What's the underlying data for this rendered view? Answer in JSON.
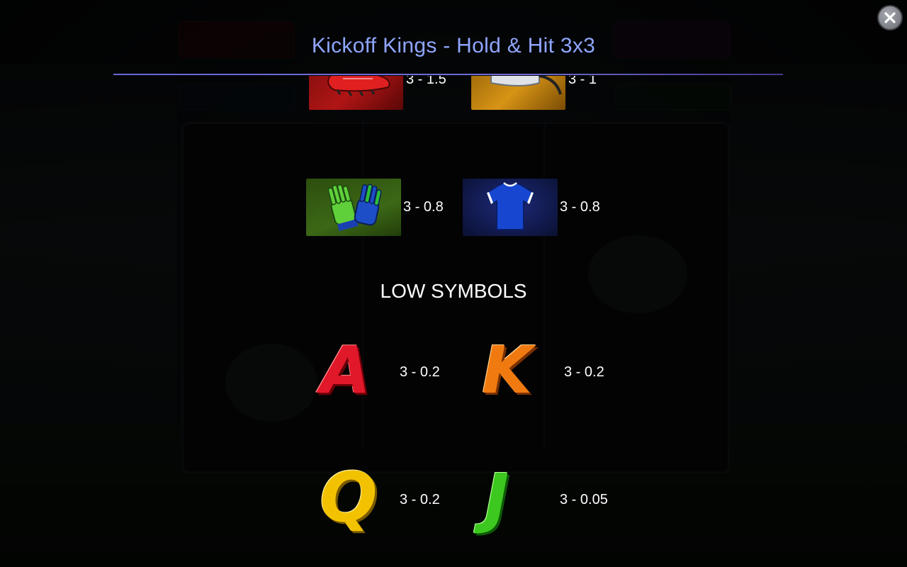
{
  "game": {
    "title": "Kickoff Kings - Hold & Hit 3x3"
  },
  "close_button": {
    "icon": "close-icon"
  },
  "paytable": {
    "partial_row": [
      {
        "symbol": "boot",
        "payout": "3 - 1.5"
      },
      {
        "symbol": "whistle",
        "payout": "3 - 1"
      }
    ],
    "mid_row": [
      {
        "symbol": "gloves",
        "payout": "3 - 0.8"
      },
      {
        "symbol": "jersey",
        "payout": "3 - 0.8"
      }
    ],
    "low_symbols_title": "LOW SYMBOLS",
    "low_symbols": [
      {
        "symbol": "A",
        "payout": "3 - 0.2",
        "color": "#e0182a"
      },
      {
        "symbol": "K",
        "payout": "3 - 0.2",
        "color": "#f07a10"
      },
      {
        "symbol": "Q",
        "payout": "3 - 0.2",
        "color": "#f2c200"
      },
      {
        "symbol": "J",
        "payout": "3 - 0.05",
        "color": "#3cc81e"
      }
    ]
  },
  "colors": {
    "title": "#8fa6ff",
    "rule": "#6a66d8",
    "overlay": "rgba(0,0,0,0.72)"
  }
}
